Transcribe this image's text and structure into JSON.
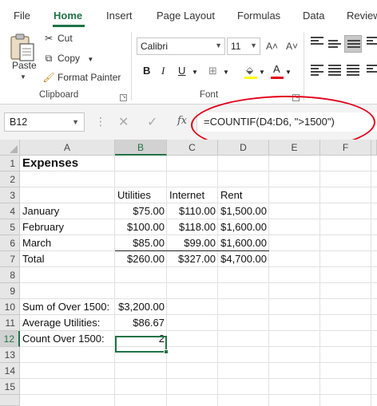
{
  "ribbon": {
    "tabs": [
      "File",
      "Home",
      "Insert",
      "Page Layout",
      "Formulas",
      "Data",
      "Review"
    ],
    "clipboard": {
      "paste": "Paste",
      "cut": "Cut",
      "copy": "Copy",
      "format_painter": "Format Painter",
      "label": "Clipboard"
    },
    "font": {
      "name": "Calibri",
      "size": "11",
      "grow": "A˄",
      "shrink": "A˅",
      "bold": "B",
      "italic": "I",
      "underline": "U",
      "font_color": "A",
      "label": "Font"
    },
    "accent_color": "#217346",
    "font_color_bar": "#e2001a",
    "highlight_color_bar": "#ffff00"
  },
  "formula_bar": {
    "name_box": "B12",
    "fx": "fx",
    "formula": "=COUNTIF(D4:D6, \">1500\")",
    "annotation_color": "#e2001a"
  },
  "sheet": {
    "columns": [
      "A",
      "B",
      "C",
      "D",
      "E",
      "F"
    ],
    "selected_column": "B",
    "rows": [
      "1",
      "2",
      "3",
      "4",
      "5",
      "6",
      "7",
      "8",
      "9",
      "10",
      "11",
      "12",
      "13",
      "14",
      "15"
    ],
    "selected_row": "12",
    "selected_cell": "B12",
    "cells": {
      "A1": "Expenses",
      "B3": "Utilities",
      "C3": "Internet",
      "D3": "Rent",
      "A4": "January",
      "B4": "$75.00",
      "C4": "$110.00",
      "D4": "$1,500.00",
      "A5": "February",
      "B5": "$100.00",
      "C5": "$118.00",
      "D5": "$1,600.00",
      "A6": "March",
      "B6": "$85.00",
      "C6": "$99.00",
      "D6": "$1,600.00",
      "A7": "Total",
      "B7": "$260.00",
      "C7": "$327.00",
      "D7": "$4,700.00",
      "A10": "Sum of Over 1500:",
      "B10": "$3,200.00",
      "A11": "Average Utilities:",
      "B11": "$86.67",
      "A12": "Count Over 1500:",
      "B12": "2"
    }
  }
}
